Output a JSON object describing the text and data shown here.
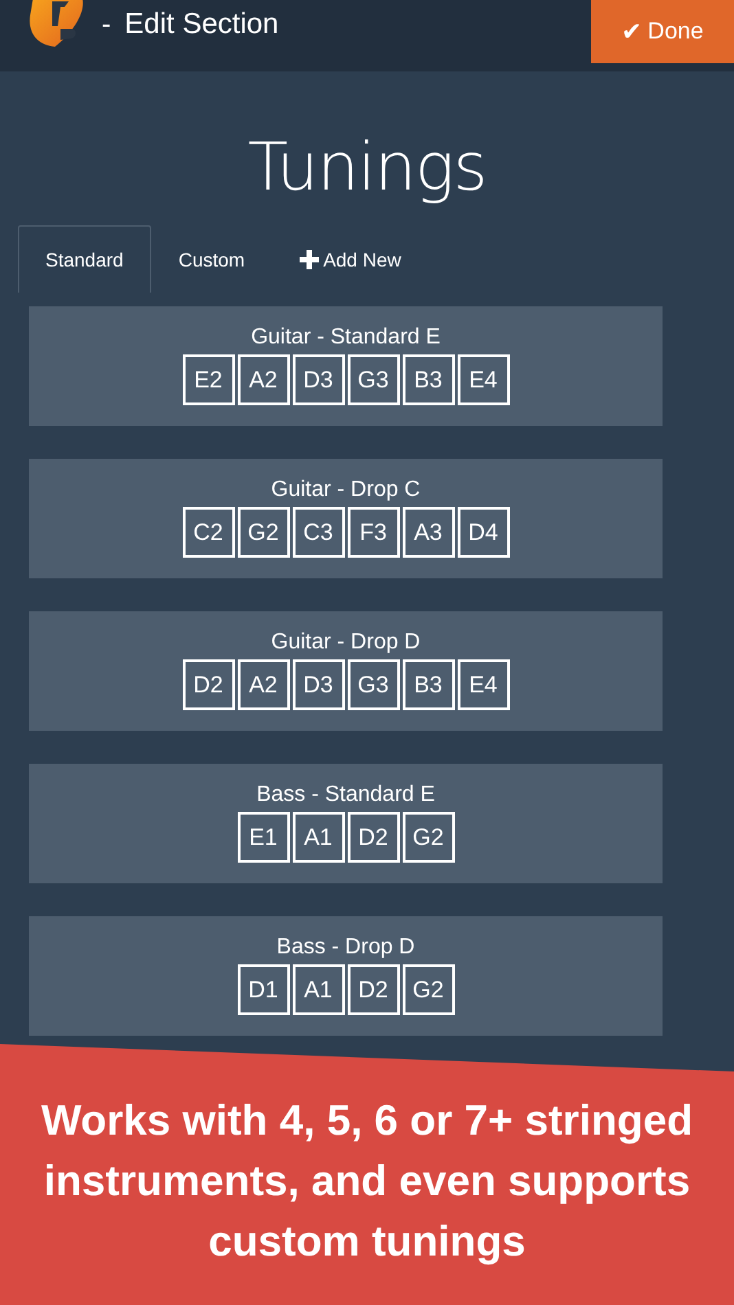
{
  "header": {
    "separator": "-",
    "title": "Edit Section",
    "done_button": {
      "icon": "✔",
      "label": "Done"
    }
  },
  "heading": "Tunings",
  "tabs": [
    {
      "label": "Standard",
      "selected": true,
      "kind": "tab"
    },
    {
      "label": "Custom",
      "selected": false,
      "kind": "tab"
    },
    {
      "label": "Add New",
      "selected": false,
      "kind": "add"
    }
  ],
  "tunings": [
    {
      "name": "Guitar - Standard E",
      "notes": [
        "E2",
        "A2",
        "D3",
        "G3",
        "B3",
        "E4"
      ]
    },
    {
      "name": "Guitar - Drop C",
      "notes": [
        "C2",
        "G2",
        "C3",
        "F3",
        "A3",
        "D4"
      ]
    },
    {
      "name": "Guitar - Drop D",
      "notes": [
        "D2",
        "A2",
        "D3",
        "G3",
        "B3",
        "E4"
      ]
    },
    {
      "name": "Bass - Standard E",
      "notes": [
        "E1",
        "A1",
        "D2",
        "G2"
      ]
    },
    {
      "name": "Bass - Drop D",
      "notes": [
        "D1",
        "A1",
        "D2",
        "G2"
      ]
    }
  ],
  "banner": "Works with 4, 5, 6 or 7+ stringed instruments, and even supports custom tunings"
}
